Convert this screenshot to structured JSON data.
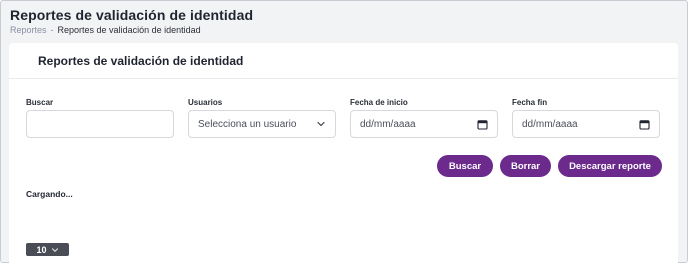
{
  "header": {
    "title": "Reportes de validación de identidad"
  },
  "breadcrumb": {
    "link": "Reportes",
    "separator": "-",
    "current": "Reportes de validación de identidad"
  },
  "card": {
    "title": "Reportes de validación de identidad"
  },
  "filters": {
    "search": {
      "label": "Buscar",
      "value": ""
    },
    "users": {
      "label": "Usuarios",
      "selected": "Selecciona un usuario"
    },
    "start_date": {
      "label": "Fecha de inicio",
      "value": "dd/mm/aaaa"
    },
    "end_date": {
      "label": "Fecha fin",
      "value": "dd/mm/aaaa"
    }
  },
  "buttons": {
    "search": "Buscar",
    "clear": "Borrar",
    "download": "Descargar reporte"
  },
  "status": {
    "loading": "Cargando..."
  },
  "pagination": {
    "page_size": "10"
  },
  "colors": {
    "accent": "#6b2a8c",
    "page_bg": "#f2f3f5",
    "card_bg": "#ffffff"
  },
  "icons": {
    "select": "chevron-down-icon",
    "date": "calendar-icon",
    "page_size": "chevron-down-icon"
  }
}
